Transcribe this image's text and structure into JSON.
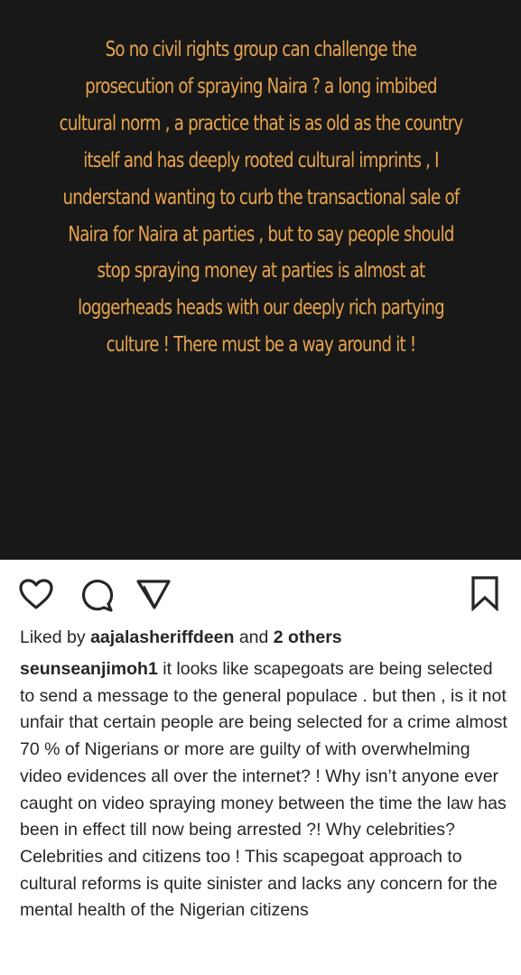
{
  "post": {
    "image_text": "So no civil rights group can challenge the prosecution of spraying Naira ? a long imbibed cultural norm , a practice that is as old as the country itself and has deeply rooted cultural imprints , I understand wanting to curb the transactional sale of Naira for Naira at parties , but to say people should stop spraying money at parties is almost at loggerheads heads with our deeply rich partying culture ! There must be a way around it !",
    "image_text_color": "#e8a44c",
    "image_background": "#181818"
  },
  "actions": {
    "like_icon": "heart-icon",
    "comment_icon": "comment-icon",
    "share_icon": "send-icon",
    "save_icon": "bookmark-icon"
  },
  "likes": {
    "prefix": "Liked by",
    "user": "aajalasheriffdeen",
    "connector": "and",
    "others": "2 others"
  },
  "caption": {
    "username": "seunseanjimoh1",
    "text": "it looks like scapegoats are being selected to send a message to the general populace . but then , is it not unfair that certain people are being selected for a crime almost 70 % of Nigerians or more are guilty of with overwhelming video evidences all over the internet? ! Why isn’t anyone ever caught on video spraying money between the time the law has been in effect till now being arrested ?! Why celebrities? Celebrities and citizens too ! This scapegoat approach to cultural reforms is quite sinister and lacks any concern for the mental health of the Nigerian citizens"
  }
}
